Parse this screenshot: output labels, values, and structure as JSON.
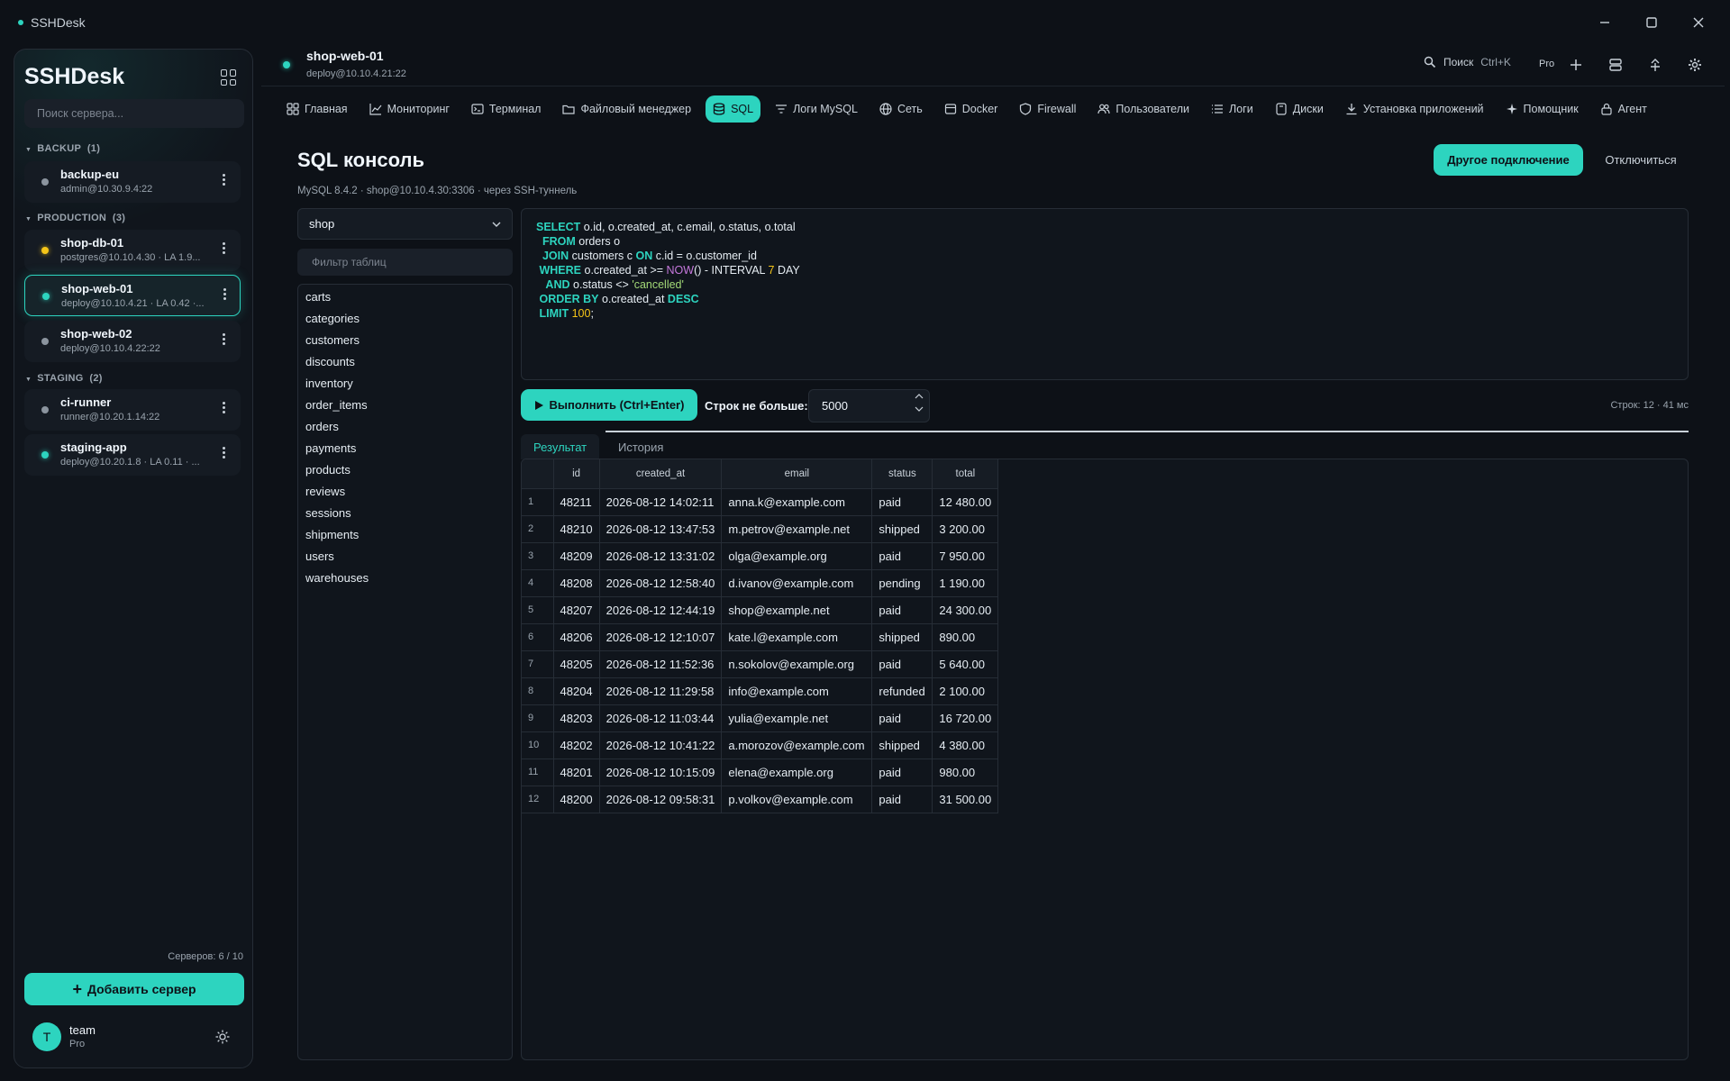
{
  "window": {
    "title": "SSHDesk"
  },
  "sidebar": {
    "brand": "SSHDesk",
    "search_placeholder": "Поиск сервера...",
    "groups": [
      {
        "name": "BACKUP",
        "count": "(1)"
      },
      {
        "name": "PRODUCTION",
        "count": "(3)"
      },
      {
        "name": "STAGING",
        "count": "(2)"
      }
    ],
    "servers": [
      {
        "name": "backup-eu",
        "host": "admin@10.30.9.4:22",
        "status": "gray"
      },
      {
        "name": "shop-db-01",
        "host": "postgres@10.10.4.30  ·  LA 1.9...",
        "status": "yellow"
      },
      {
        "name": "shop-web-01",
        "host": "deploy@10.10.4.21  ·  LA 0.42 ·...",
        "status": "green",
        "active": true
      },
      {
        "name": "shop-web-02",
        "host": "deploy@10.10.4.22:22",
        "status": "gray"
      },
      {
        "name": "ci-runner",
        "host": "runner@10.20.1.14:22",
        "status": "gray"
      },
      {
        "name": "staging-app",
        "host": "deploy@10.20.1.8  ·  LA 0.11 · ...",
        "status": "green"
      }
    ],
    "servers_count": "Серверов: 6 / 10",
    "add_server": "Добавить сервер",
    "user": {
      "initial": "T",
      "name": "team",
      "plan": "Pro"
    }
  },
  "header": {
    "server_name": "shop-web-01",
    "server_host": "deploy@10.10.4.21:22",
    "search_label": "Поиск",
    "search_shortcut": "Ctrl+K",
    "pro_label": "Pro"
  },
  "tabs": [
    {
      "label": "Главная",
      "icon": "home-icon"
    },
    {
      "label": "Мониторинг",
      "icon": "chart-icon"
    },
    {
      "label": "Терминал",
      "icon": "terminal-icon"
    },
    {
      "label": "Файловый менеджер",
      "icon": "folder-icon"
    },
    {
      "label": "SQL",
      "icon": "database-icon",
      "active": true
    },
    {
      "label": "Логи MySQL",
      "icon": "filter-icon"
    },
    {
      "label": "Сеть",
      "icon": "globe-icon"
    },
    {
      "label": "Docker",
      "icon": "box-icon"
    },
    {
      "label": "Firewall",
      "icon": "shield-icon"
    },
    {
      "label": "Пользователи",
      "icon": "users-icon"
    },
    {
      "label": "Логи",
      "icon": "list-icon"
    },
    {
      "label": "Диски",
      "icon": "disk-icon"
    },
    {
      "label": "Установка приложений",
      "icon": "download-icon"
    },
    {
      "label": "Помощник",
      "icon": "sparkle-icon"
    },
    {
      "label": "Агент",
      "icon": "lock-icon"
    }
  ],
  "page": {
    "title": "SQL консоль",
    "subtitle": "MySQL 8.4.2 · shop@10.10.4.30:3306 · через SSH-туннель",
    "btn_other_connection": "Другое подключение",
    "btn_disconnect": "Отключиться"
  },
  "db": {
    "selected": "shop",
    "filter_placeholder": "Фильтр таблиц",
    "tables": [
      "carts",
      "categories",
      "customers",
      "discounts",
      "inventory",
      "order_items",
      "orders",
      "payments",
      "products",
      "reviews",
      "sessions",
      "shipments",
      "users",
      "warehouses"
    ]
  },
  "editor": {
    "lines": [
      [
        [
          "kw",
          "SELECT"
        ],
        [
          "t",
          " o.id, o.created_at, c.email, o.status, o.total"
        ]
      ],
      [
        [
          "t",
          "  "
        ],
        [
          "kw",
          "FROM"
        ],
        [
          "t",
          " orders o"
        ]
      ],
      [
        [
          "t",
          "  "
        ],
        [
          "kw",
          "JOIN"
        ],
        [
          "t",
          " customers c "
        ],
        [
          "kw",
          "ON"
        ],
        [
          "t",
          " c.id = o.customer_id"
        ]
      ],
      [
        [
          "t",
          " "
        ],
        [
          "kw",
          "WHERE"
        ],
        [
          "t",
          " o.created_at >= "
        ],
        [
          "fn",
          "NOW"
        ],
        [
          "t",
          "() - INTERVAL "
        ],
        [
          "num",
          "7"
        ],
        [
          "t",
          " DAY"
        ]
      ],
      [
        [
          "t",
          "   "
        ],
        [
          "kw",
          "AND"
        ],
        [
          "t",
          " o.status <> "
        ],
        [
          "str",
          "'cancelled'"
        ]
      ],
      [
        [
          "t",
          " "
        ],
        [
          "kw",
          "ORDER BY"
        ],
        [
          "t",
          " o.created_at "
        ],
        [
          "kw",
          "DESC"
        ]
      ],
      [
        [
          "t",
          " "
        ],
        [
          "kw",
          "LIMIT"
        ],
        [
          "t",
          " "
        ],
        [
          "num",
          "100"
        ],
        [
          "t",
          ";"
        ]
      ]
    ]
  },
  "run": {
    "button": "Выполнить (Ctrl+Enter)",
    "rows_label": "Строк не больше:",
    "rows_value": "5000",
    "meta": "Строк: 12 · 41 мс"
  },
  "result_tabs": [
    "Результат",
    "История"
  ],
  "results": {
    "columns": [
      "id",
      "created_at",
      "email",
      "status",
      "total"
    ],
    "rows": [
      [
        "48211",
        "2026-08-12 14:02:11",
        "anna.k@example.com",
        "paid",
        "12 480.00"
      ],
      [
        "48210",
        "2026-08-12 13:47:53",
        "m.petrov@example.net",
        "shipped",
        "3 200.00"
      ],
      [
        "48209",
        "2026-08-12 13:31:02",
        "olga@example.org",
        "paid",
        "7 950.00"
      ],
      [
        "48208",
        "2026-08-12 12:58:40",
        "d.ivanov@example.com",
        "pending",
        "1 190.00"
      ],
      [
        "48207",
        "2026-08-12 12:44:19",
        "shop@example.net",
        "paid",
        "24 300.00"
      ],
      [
        "48206",
        "2026-08-12 12:10:07",
        "kate.l@example.com",
        "shipped",
        "890.00"
      ],
      [
        "48205",
        "2026-08-12 11:52:36",
        "n.sokolov@example.org",
        "paid",
        "5 640.00"
      ],
      [
        "48204",
        "2026-08-12 11:29:58",
        "info@example.com",
        "refunded",
        "2 100.00"
      ],
      [
        "48203",
        "2026-08-12 11:03:44",
        "yulia@example.net",
        "paid",
        "16 720.00"
      ],
      [
        "48202",
        "2026-08-12 10:41:22",
        "a.morozov@example.com",
        "shipped",
        "4 380.00"
      ],
      [
        "48201",
        "2026-08-12 10:15:09",
        "elena@example.org",
        "paid",
        "980.00"
      ],
      [
        "48200",
        "2026-08-12 09:58:31",
        "p.volkov@example.com",
        "paid",
        "31 500.00"
      ]
    ]
  },
  "colors": {
    "accent": "#2dd4bf",
    "background": "#0d1117",
    "warning": "#f5c518"
  }
}
